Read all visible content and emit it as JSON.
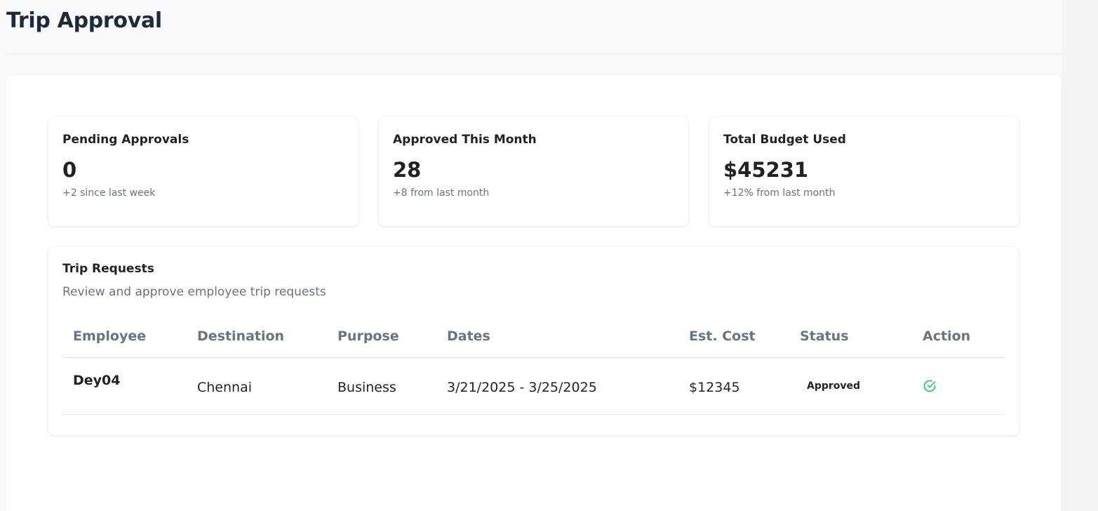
{
  "page": {
    "title": "Trip Approval"
  },
  "stats": [
    {
      "title": "Pending Approvals",
      "value": "0",
      "sub": "+2 since last week"
    },
    {
      "title": "Approved This Month",
      "value": "28",
      "sub": "+8 from last month"
    },
    {
      "title": "Total Budget Used",
      "value": "$45231",
      "sub": "+12% from last month"
    }
  ],
  "requests": {
    "title": "Trip Requests",
    "description": "Review and approve employee trip requests",
    "columns": [
      "Employee",
      "Destination",
      "Purpose",
      "Dates",
      "Est. Cost",
      "Status",
      "Action"
    ],
    "rows": [
      {
        "employee": "Dey04",
        "destination": "Chennai",
        "purpose": "Business",
        "dates": "3/21/2025 - 3/25/2025",
        "cost": "$12345",
        "status": "Approved",
        "action_icon": "check-circle-icon"
      }
    ]
  },
  "colors": {
    "approve_icon": "#22c55e",
    "muted_text": "#6b7280"
  }
}
